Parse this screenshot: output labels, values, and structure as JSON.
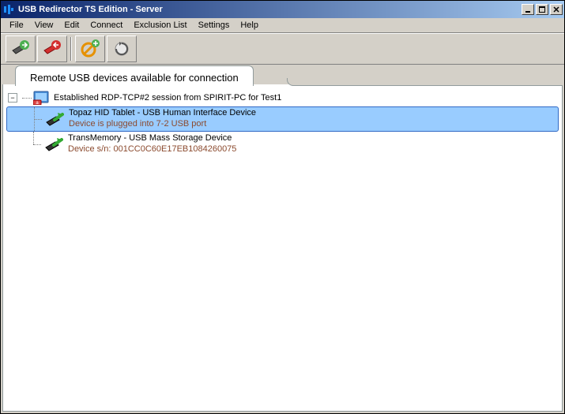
{
  "window": {
    "title": "USB Redirector TS Edition - Server"
  },
  "menu": {
    "file": "File",
    "view": "View",
    "edit": "Edit",
    "connect": "Connect",
    "exclusion": "Exclusion List",
    "settings": "Settings",
    "help": "Help"
  },
  "tab": {
    "label": "Remote USB devices available for connection"
  },
  "tree": {
    "session": {
      "expander": "−",
      "label": "Established RDP-TCP#2 session from SPIRIT-PC for Test1"
    },
    "devices": [
      {
        "name": "Topaz HID Tablet - USB Human Interface Device",
        "detail": "Device is plugged into 7-2 USB port",
        "selected": true
      },
      {
        "name": "TransMemory - USB Mass Storage Device",
        "detail": "Device s/n: 001CC0C60E17EB1084260075",
        "selected": false
      }
    ]
  }
}
